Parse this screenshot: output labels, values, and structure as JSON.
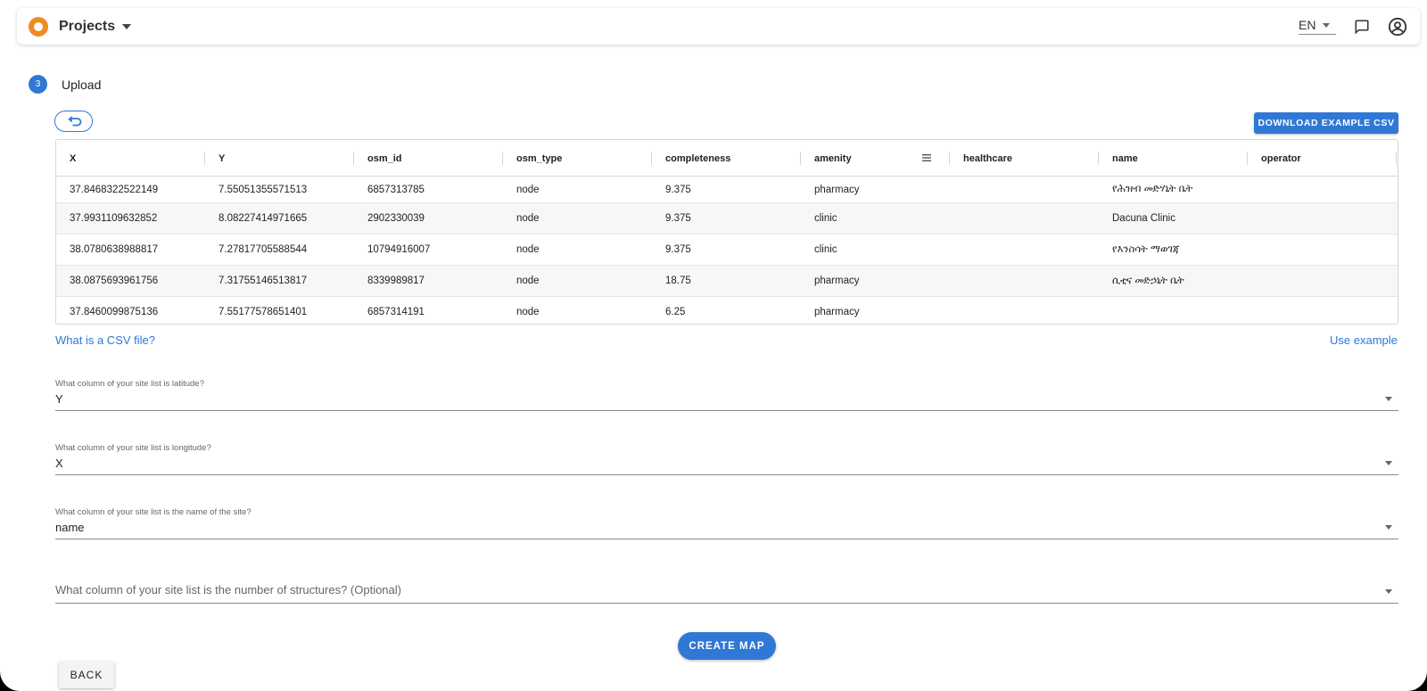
{
  "header": {
    "brand": "Projects",
    "language": "EN",
    "icons": [
      "chat-icon",
      "account-icon"
    ]
  },
  "step": {
    "number": "3",
    "label": "Upload"
  },
  "download_button": "DOWNLOAD EXAMPLE CSV",
  "table": {
    "columns": [
      "X",
      "Y",
      "osm_id",
      "osm_type",
      "completeness",
      "amenity",
      "healthcare",
      "name",
      "operator"
    ],
    "rows": [
      [
        "37.8468322522149",
        "7.55051355571513",
        "6857313785",
        "node",
        "9.375",
        "pharmacy",
        "",
        "የሕዝብ መድሃኒት ቤት",
        ""
      ],
      [
        "37.9931109632852",
        "8.08227414971665",
        "2902330039",
        "node",
        "9.375",
        "clinic",
        "",
        "Dacuna Clinic",
        ""
      ],
      [
        "38.0780638988817",
        "7.27817705588544",
        "10794916007",
        "node",
        "9.375",
        "clinic",
        "",
        "የእንስሳት ማወገጃ",
        ""
      ],
      [
        "38.0875693961756",
        "7.31755146513817",
        "8339989817",
        "node",
        "18.75",
        "pharmacy",
        "",
        "ሲቲና መድኃኒት ቤት",
        ""
      ],
      [
        "37.8460099875136",
        "7.55177578651401",
        "6857314191",
        "node",
        "6.25",
        "pharmacy",
        "",
        "",
        ""
      ]
    ]
  },
  "links": {
    "csv_help": "What is a CSV file?",
    "use_example": "Use example"
  },
  "fields": {
    "latitude": {
      "label": "What column of your site list is latitude?",
      "value": "Y"
    },
    "longitude": {
      "label": "What column of your site list is longitude?",
      "value": "X"
    },
    "site_name": {
      "label": "What column of your site list is the name of the site?",
      "value": "name"
    },
    "structures": {
      "placeholder": "What column of your site list is the number of structures? (Optional)"
    }
  },
  "buttons": {
    "create_map": "CREATE MAP",
    "back": "BACK"
  },
  "colors": {
    "primary": "#2f78d6",
    "logo": "#f08a24"
  }
}
